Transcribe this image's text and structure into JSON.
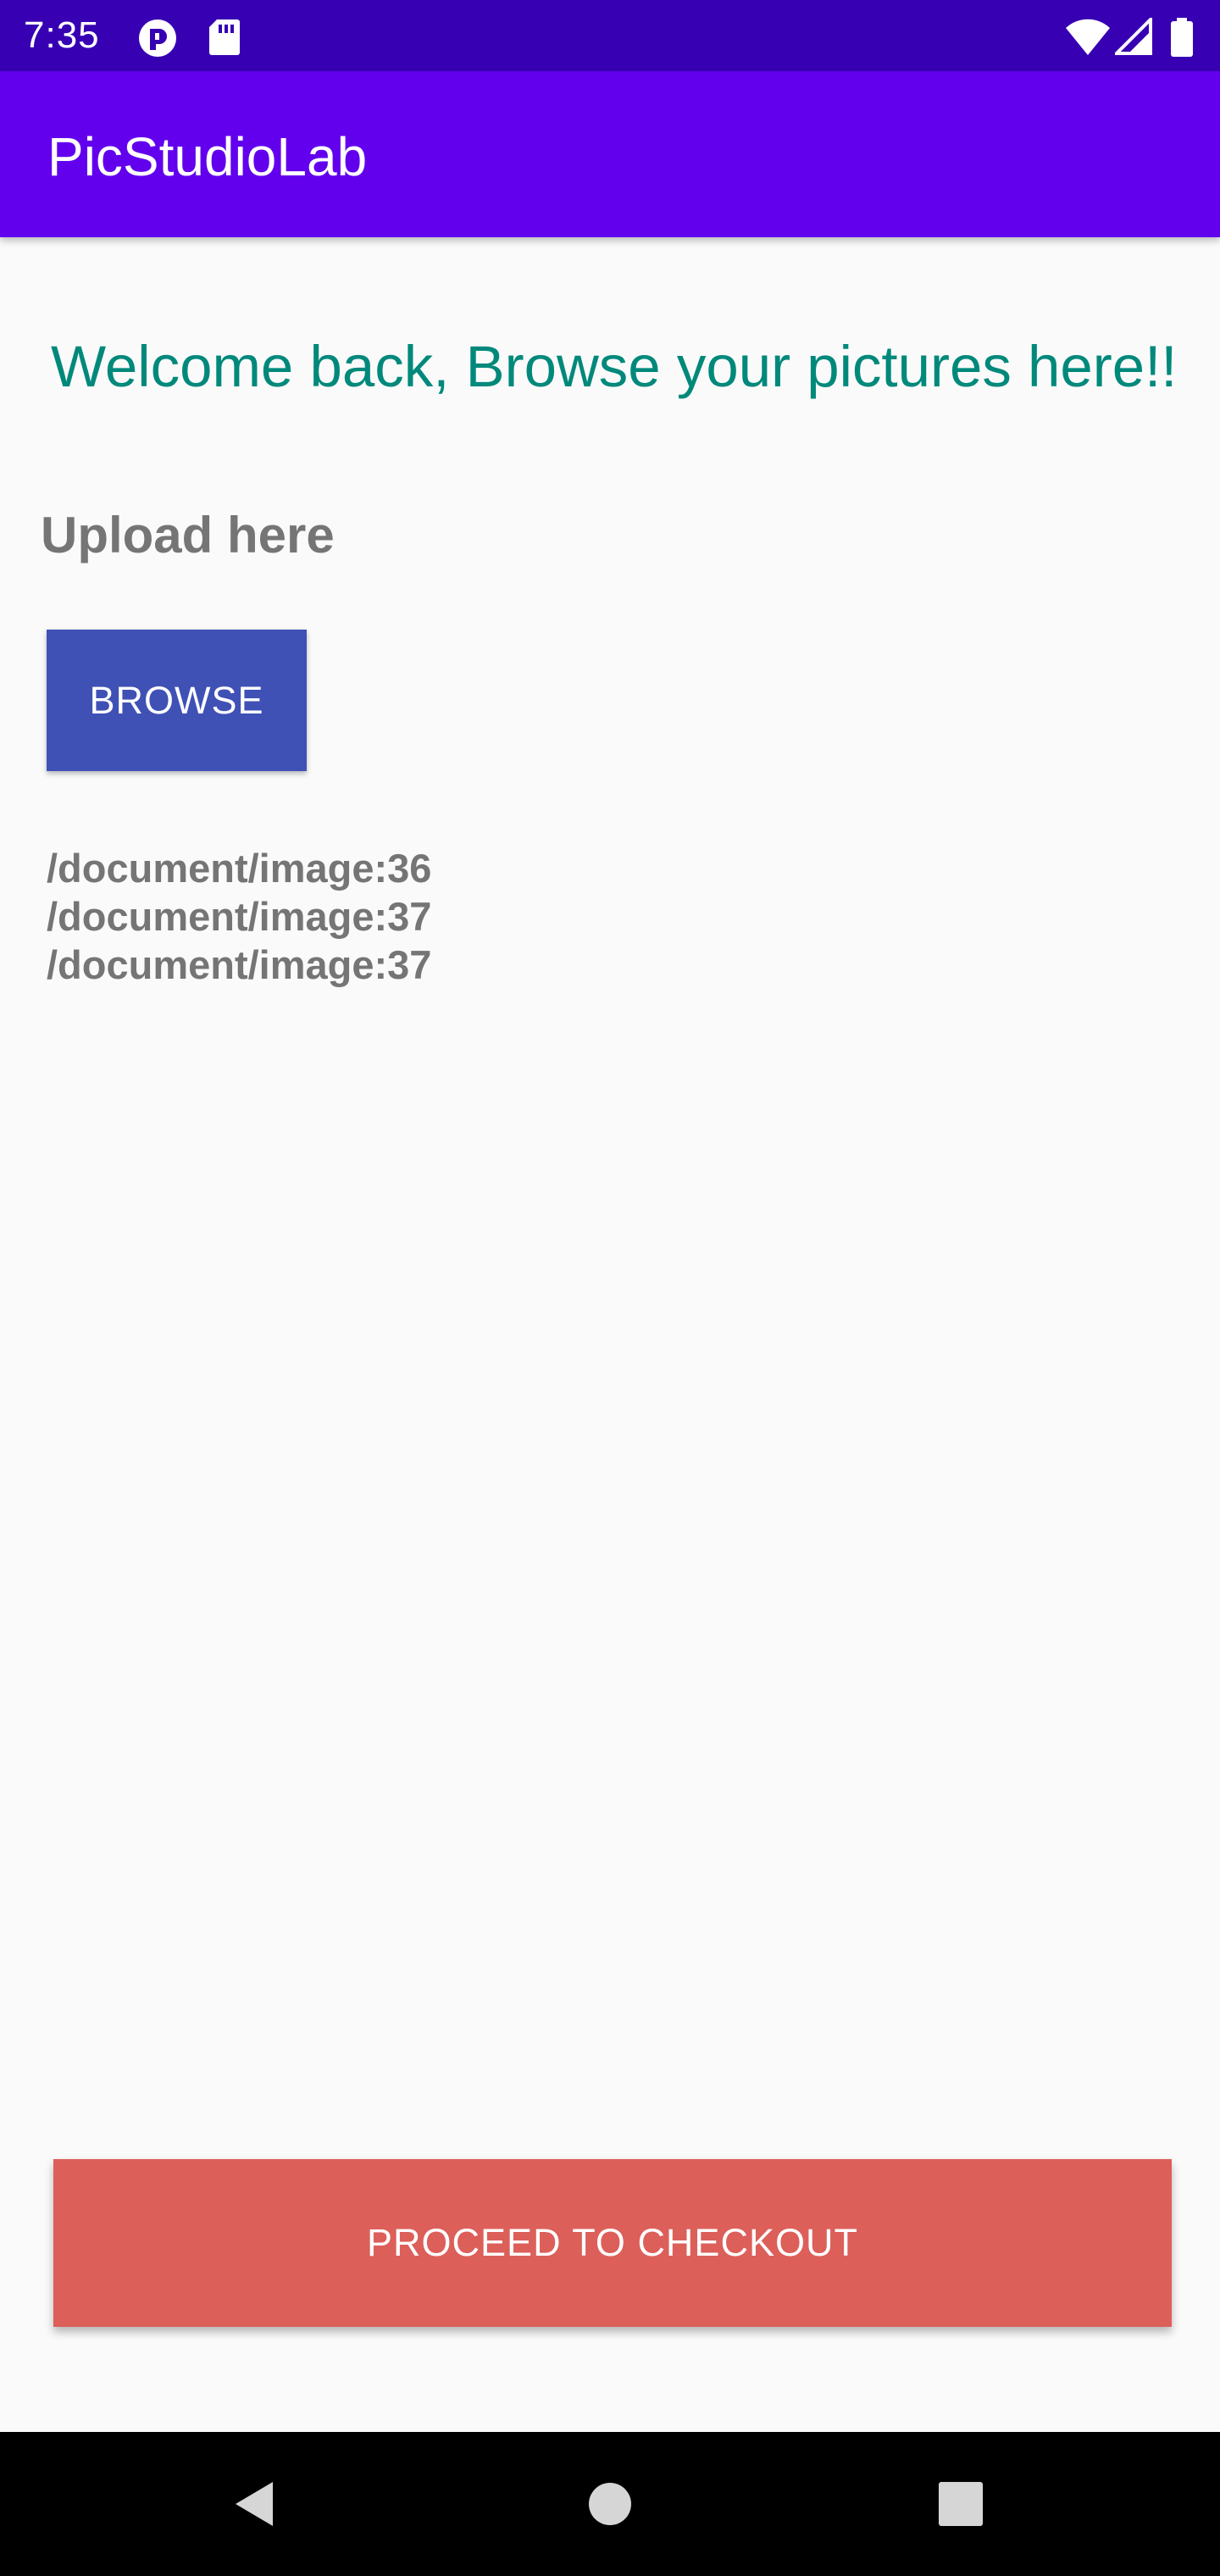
{
  "status_bar": {
    "time": "7:35",
    "icons": [
      "notification-app-icon",
      "sd-card-icon",
      "wifi-icon",
      "cell-signal-icon",
      "battery-icon"
    ],
    "background": "#3700b3"
  },
  "app_bar": {
    "title": "PicStudioLab",
    "background": "#6200ee"
  },
  "main": {
    "welcome": "Welcome back, Browse your pictures here!!",
    "upload_label": "Upload here",
    "browse_label": "BROWSE",
    "files": [
      "/document/image:36",
      "/document/image:37",
      "/document/image:37"
    ],
    "checkout_label": "PROCEED TO CHECKOUT"
  },
  "nav_bar": {
    "buttons": [
      "back-icon",
      "home-icon",
      "recents-icon"
    ]
  },
  "colors": {
    "accent_teal": "#00897b",
    "browse_button": "#3f51b5",
    "checkout_button": "#dc5f5a",
    "secondary_text": "#757575"
  }
}
